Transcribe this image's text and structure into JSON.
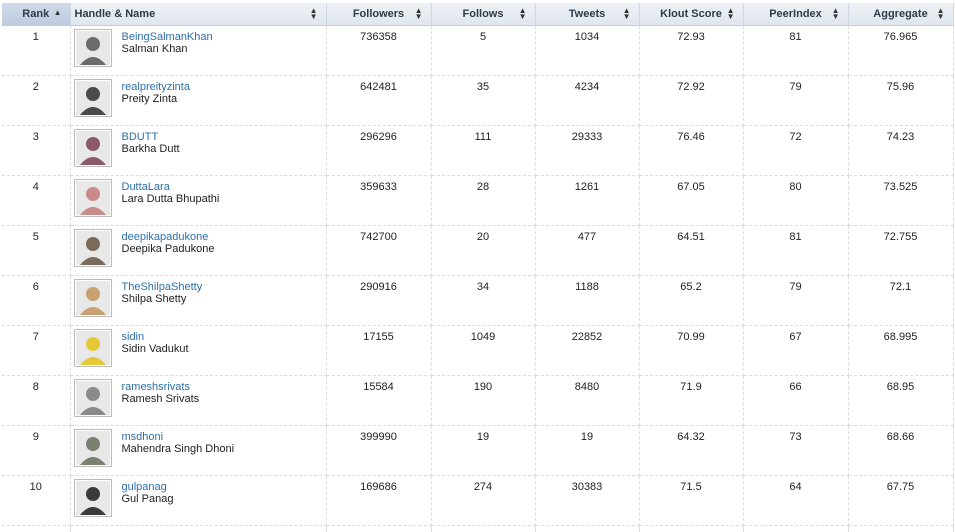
{
  "columns": [
    {
      "label": "Rank",
      "sort_icon": "caret-up-icon"
    },
    {
      "label": "Handle & Name",
      "sort_icon": "sort-both-icon"
    },
    {
      "label": "Followers",
      "sort_icon": "sort-both-icon"
    },
    {
      "label": "Follows",
      "sort_icon": "sort-both-icon"
    },
    {
      "label": "Tweets",
      "sort_icon": "sort-both-icon"
    },
    {
      "label": "Klout Score",
      "sort_icon": "sort-both-icon"
    },
    {
      "label": "PeerIndex",
      "sort_icon": "sort-both-icon"
    },
    {
      "label": "Aggregate",
      "sort_icon": "sort-both-icon"
    }
  ],
  "rows": [
    {
      "rank": "1",
      "handle": "BeingSalmanKhan",
      "name": "Salman Khan",
      "followers": "736358",
      "follows": "5",
      "tweets": "1034",
      "klout": "72.93",
      "peerindex": "81",
      "aggregate": "76.965",
      "avatar_color": "#6b6b6b"
    },
    {
      "rank": "2",
      "handle": "realpreityzinta",
      "name": "Preity Zinta",
      "followers": "642481",
      "follows": "35",
      "tweets": "4234",
      "klout": "72.92",
      "peerindex": "79",
      "aggregate": "75.96",
      "avatar_color": "#4a4a4a"
    },
    {
      "rank": "3",
      "handle": "BDUTT",
      "name": "Barkha Dutt",
      "followers": "296296",
      "follows": "111",
      "tweets": "29333",
      "klout": "76.46",
      "peerindex": "72",
      "aggregate": "74.23",
      "avatar_color": "#8a5a6a"
    },
    {
      "rank": "4",
      "handle": "DuttaLara",
      "name": "Lara Dutta Bhupathi",
      "followers": "359633",
      "follows": "28",
      "tweets": "1261",
      "klout": "67.05",
      "peerindex": "80",
      "aggregate": "73.525",
      "avatar_color": "#c98a8a"
    },
    {
      "rank": "5",
      "handle": "deepikapadukone",
      "name": "Deepika Padukone",
      "followers": "742700",
      "follows": "20",
      "tweets": "477",
      "klout": "64.51",
      "peerindex": "81",
      "aggregate": "72.755",
      "avatar_color": "#7a6a5a"
    },
    {
      "rank": "6",
      "handle": "TheShilpaShetty",
      "name": "Shilpa Shetty",
      "followers": "290916",
      "follows": "34",
      "tweets": "1188",
      "klout": "65.2",
      "peerindex": "79",
      "aggregate": "72.1",
      "avatar_color": "#c9a070"
    },
    {
      "rank": "7",
      "handle": "sidin",
      "name": "Sidin Vadukut",
      "followers": "17155",
      "follows": "1049",
      "tweets": "22852",
      "klout": "70.99",
      "peerindex": "67",
      "aggregate": "68.995",
      "avatar_color": "#e3c83a"
    },
    {
      "rank": "8",
      "handle": "rameshsrivats",
      "name": "Ramesh Srivats",
      "followers": "15584",
      "follows": "190",
      "tweets": "8480",
      "klout": "71.9",
      "peerindex": "66",
      "aggregate": "68.95",
      "avatar_color": "#8a8a8a"
    },
    {
      "rank": "9",
      "handle": "msdhoni",
      "name": "Mahendra Singh Dhoni",
      "followers": "399990",
      "follows": "19",
      "tweets": "19",
      "klout": "64.32",
      "peerindex": "73",
      "aggregate": "68.66",
      "avatar_color": "#7a8070"
    },
    {
      "rank": "10",
      "handle": "gulpanag",
      "name": "Gul Panag",
      "followers": "169686",
      "follows": "274",
      "tweets": "30383",
      "klout": "71.5",
      "peerindex": "64",
      "aggregate": "67.75",
      "avatar_color": "#3a3a3a"
    }
  ]
}
